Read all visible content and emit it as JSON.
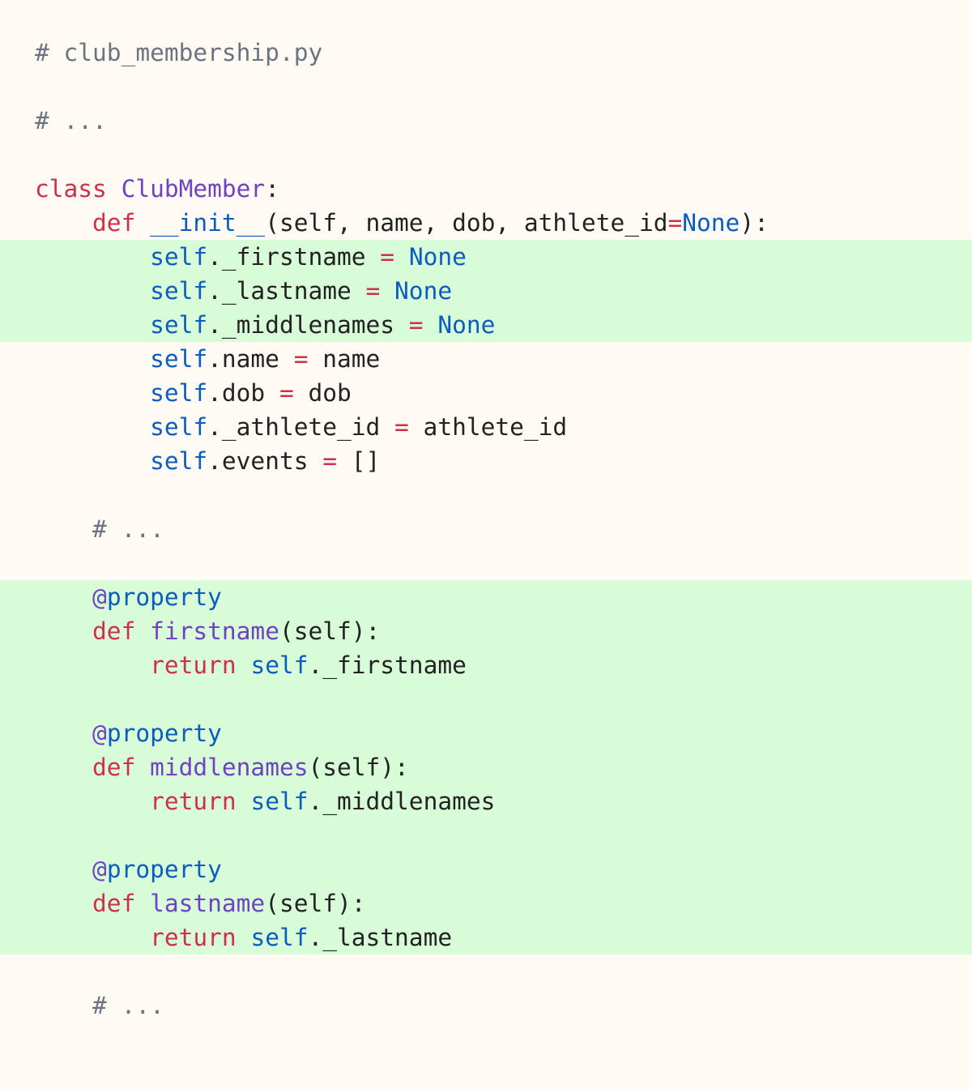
{
  "lines": [
    {
      "id": "l1",
      "tokens": [
        {
          "c": "comment",
          "t": "# club_membership.py"
        }
      ]
    },
    {
      "id": "l2",
      "tokens": []
    },
    {
      "id": "l3",
      "tokens": [
        {
          "c": "comment",
          "t": "# ..."
        }
      ]
    },
    {
      "id": "l4",
      "tokens": []
    },
    {
      "id": "l5",
      "tokens": [
        {
          "c": "kw",
          "t": "class"
        },
        {
          "c": "plain",
          "t": " "
        },
        {
          "c": "cls",
          "t": "ClubMember"
        },
        {
          "c": "plain",
          "t": ":"
        }
      ]
    },
    {
      "id": "l6",
      "tokens": [
        {
          "c": "plain",
          "t": "    "
        },
        {
          "c": "kw",
          "t": "def"
        },
        {
          "c": "plain",
          "t": " "
        },
        {
          "c": "bi",
          "t": "__init__"
        },
        {
          "c": "plain",
          "t": "(self, name, dob, athlete_id"
        },
        {
          "c": "op",
          "t": "="
        },
        {
          "c": "bi",
          "t": "None"
        },
        {
          "c": "plain",
          "t": "):"
        }
      ]
    },
    {
      "id": "l7",
      "hl": true,
      "tokens": [
        {
          "c": "plain",
          "t": "        "
        },
        {
          "c": "bi",
          "t": "self"
        },
        {
          "c": "plain",
          "t": "._firstname "
        },
        {
          "c": "op",
          "t": "="
        },
        {
          "c": "plain",
          "t": " "
        },
        {
          "c": "bi",
          "t": "None"
        }
      ]
    },
    {
      "id": "l8",
      "hl": true,
      "tokens": [
        {
          "c": "plain",
          "t": "        "
        },
        {
          "c": "bi",
          "t": "self"
        },
        {
          "c": "plain",
          "t": "._lastname "
        },
        {
          "c": "op",
          "t": "="
        },
        {
          "c": "plain",
          "t": " "
        },
        {
          "c": "bi",
          "t": "None"
        }
      ]
    },
    {
      "id": "l9",
      "hl": true,
      "tokens": [
        {
          "c": "plain",
          "t": "        "
        },
        {
          "c": "bi",
          "t": "self"
        },
        {
          "c": "plain",
          "t": "._middlenames "
        },
        {
          "c": "op",
          "t": "="
        },
        {
          "c": "plain",
          "t": " "
        },
        {
          "c": "bi",
          "t": "None"
        }
      ]
    },
    {
      "id": "l10",
      "tokens": [
        {
          "c": "plain",
          "t": "        "
        },
        {
          "c": "bi",
          "t": "self"
        },
        {
          "c": "plain",
          "t": ".name "
        },
        {
          "c": "op",
          "t": "="
        },
        {
          "c": "plain",
          "t": " name"
        }
      ]
    },
    {
      "id": "l11",
      "tokens": [
        {
          "c": "plain",
          "t": "        "
        },
        {
          "c": "bi",
          "t": "self"
        },
        {
          "c": "plain",
          "t": ".dob "
        },
        {
          "c": "op",
          "t": "="
        },
        {
          "c": "plain",
          "t": " dob"
        }
      ]
    },
    {
      "id": "l12",
      "tokens": [
        {
          "c": "plain",
          "t": "        "
        },
        {
          "c": "bi",
          "t": "self"
        },
        {
          "c": "plain",
          "t": "._athlete_id "
        },
        {
          "c": "op",
          "t": "="
        },
        {
          "c": "plain",
          "t": " athlete_id"
        }
      ]
    },
    {
      "id": "l13",
      "tokens": [
        {
          "c": "plain",
          "t": "        "
        },
        {
          "c": "bi",
          "t": "self"
        },
        {
          "c": "plain",
          "t": ".events "
        },
        {
          "c": "op",
          "t": "="
        },
        {
          "c": "plain",
          "t": " []"
        }
      ]
    },
    {
      "id": "l14",
      "tokens": []
    },
    {
      "id": "l15",
      "tokens": [
        {
          "c": "plain",
          "t": "    "
        },
        {
          "c": "comment",
          "t": "# ..."
        }
      ]
    },
    {
      "id": "l16",
      "tokens": []
    },
    {
      "id": "l17",
      "hl": true,
      "tokens": [
        {
          "c": "plain",
          "t": "    "
        },
        {
          "c": "dec",
          "t": "@"
        },
        {
          "c": "bi",
          "t": "property"
        }
      ]
    },
    {
      "id": "l18",
      "hl": true,
      "tokens": [
        {
          "c": "plain",
          "t": "    "
        },
        {
          "c": "kw",
          "t": "def"
        },
        {
          "c": "plain",
          "t": " "
        },
        {
          "c": "fn",
          "t": "firstname"
        },
        {
          "c": "plain",
          "t": "(self):"
        }
      ]
    },
    {
      "id": "l19",
      "hl": true,
      "tokens": [
        {
          "c": "plain",
          "t": "        "
        },
        {
          "c": "kw",
          "t": "return"
        },
        {
          "c": "plain",
          "t": " "
        },
        {
          "c": "bi",
          "t": "self"
        },
        {
          "c": "plain",
          "t": "._firstname"
        }
      ]
    },
    {
      "id": "l20",
      "hl": true,
      "tokens": []
    },
    {
      "id": "l21",
      "hl": true,
      "tokens": [
        {
          "c": "plain",
          "t": "    "
        },
        {
          "c": "dec",
          "t": "@"
        },
        {
          "c": "bi",
          "t": "property"
        }
      ]
    },
    {
      "id": "l22",
      "hl": true,
      "tokens": [
        {
          "c": "plain",
          "t": "    "
        },
        {
          "c": "kw",
          "t": "def"
        },
        {
          "c": "plain",
          "t": " "
        },
        {
          "c": "fn",
          "t": "middlenames"
        },
        {
          "c": "plain",
          "t": "(self):"
        }
      ]
    },
    {
      "id": "l23",
      "hl": true,
      "tokens": [
        {
          "c": "plain",
          "t": "        "
        },
        {
          "c": "kw",
          "t": "return"
        },
        {
          "c": "plain",
          "t": " "
        },
        {
          "c": "bi",
          "t": "self"
        },
        {
          "c": "plain",
          "t": "._middlenames"
        }
      ]
    },
    {
      "id": "l24",
      "hl": true,
      "tokens": []
    },
    {
      "id": "l25",
      "hl": true,
      "tokens": [
        {
          "c": "plain",
          "t": "    "
        },
        {
          "c": "dec",
          "t": "@"
        },
        {
          "c": "bi",
          "t": "property"
        }
      ]
    },
    {
      "id": "l26",
      "hl": true,
      "tokens": [
        {
          "c": "plain",
          "t": "    "
        },
        {
          "c": "kw",
          "t": "def"
        },
        {
          "c": "plain",
          "t": " "
        },
        {
          "c": "fn",
          "t": "lastname"
        },
        {
          "c": "plain",
          "t": "(self):"
        }
      ]
    },
    {
      "id": "l27",
      "hl": true,
      "tokens": [
        {
          "c": "plain",
          "t": "        "
        },
        {
          "c": "kw",
          "t": "return"
        },
        {
          "c": "plain",
          "t": " "
        },
        {
          "c": "bi",
          "t": "self"
        },
        {
          "c": "plain",
          "t": "._lastname"
        }
      ]
    },
    {
      "id": "l28",
      "tokens": []
    },
    {
      "id": "l29",
      "tokens": [
        {
          "c": "plain",
          "t": "    "
        },
        {
          "c": "comment",
          "t": "# ..."
        }
      ]
    }
  ]
}
